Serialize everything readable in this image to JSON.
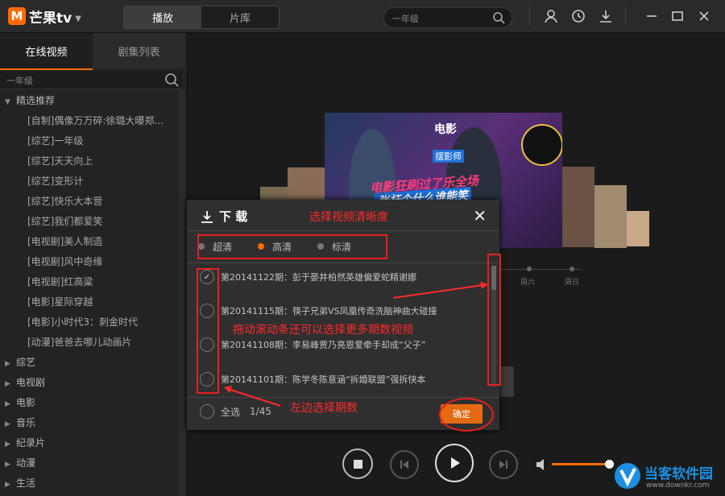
{
  "app": {
    "logo_text": "芒果tv",
    "logo_mark": "M"
  },
  "main_tabs": [
    {
      "label": "播放",
      "active": true
    },
    {
      "label": "片库",
      "active": false
    }
  ],
  "top_search": {
    "value": "一年级"
  },
  "left_tabs": [
    {
      "label": "在线视频",
      "active": true
    },
    {
      "label": "剧集列表",
      "active": false
    }
  ],
  "left_search": {
    "value": "一年级"
  },
  "tree": {
    "featured": {
      "label": "精选推荐",
      "expanded": true,
      "items": [
        "[自制]偶像万万碎:徐璐大曝郑...",
        "[综艺]一年级",
        "[综艺]天天向上",
        "[综艺]变形计",
        "[综艺]快乐大本营",
        "[综艺]我们都爱笑",
        "[电视剧]美人制造",
        "[电视剧]风中奇缘",
        "[电视剧]红高粱",
        "[电影]星际穿越",
        "[电影]小时代3：刺金时代",
        "[动漫]爸爸去哪儿动画片"
      ]
    },
    "categories": [
      "综艺",
      "电视剧",
      "电影",
      "音乐",
      "纪录片",
      "动漫",
      "生活"
    ]
  },
  "carousel": {
    "overlay_line1": "电影狂刷过了乐全场",
    "overlay_line2": "张杆个什么谁能笑",
    "side_logo": "电影",
    "side_label": "摆影师"
  },
  "background_days": [
    "周六",
    "周日"
  ],
  "dialog": {
    "title": "下 载",
    "quality_options": [
      {
        "label": "超清",
        "selected": false
      },
      {
        "label": "高清",
        "selected": true
      },
      {
        "label": "标清",
        "selected": false
      }
    ],
    "episodes": [
      {
        "label": "第20141122期：彭于晏井柏然英雄偏爱蛇精谢娜",
        "checked": true
      },
      {
        "label": "第20141115期：筷子兄弟VS凤凰传奇洗脑神曲大碰撞",
        "checked": false
      },
      {
        "label": "第20141108期：李易峰贾乃亮恩爱牵手却成“父子”",
        "checked": false
      },
      {
        "label": "第20141101期：陈学冬陈意涵“拆婚联盟”强拆快本",
        "checked": false
      }
    ],
    "select_all_label": "全选",
    "count": "1/45",
    "confirm_label": "确定"
  },
  "annotations": {
    "quality": "选择视频清晰度",
    "scroll": "拖动滚动条还可以选择更多期数视频",
    "left": "左边选择期数"
  },
  "player": {
    "volume": 0.95
  },
  "watermark": {
    "text": "当客软件园",
    "url": "www.downkr.com"
  },
  "colors": {
    "accent": "#ff6a00",
    "annotation": "#e82020",
    "confirm": "#e36a12"
  }
}
